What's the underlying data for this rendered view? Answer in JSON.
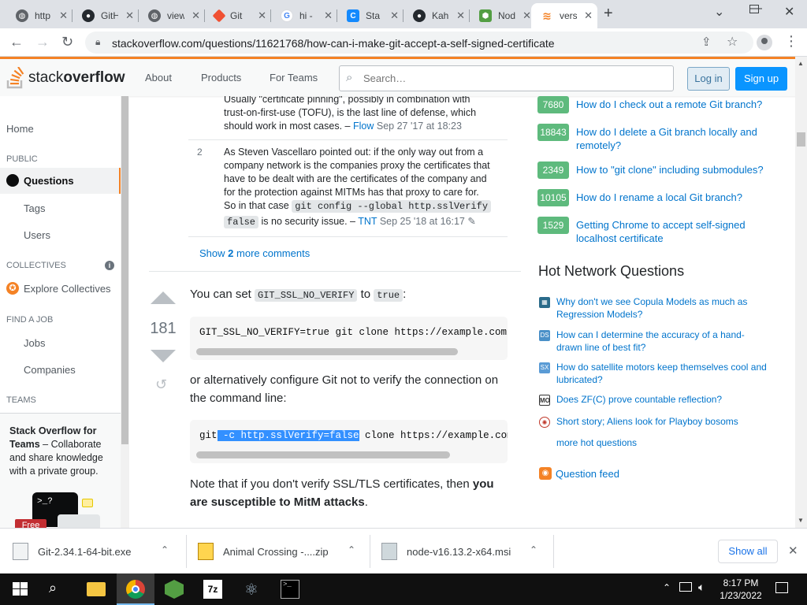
{
  "browser": {
    "tabs": [
      {
        "label": "http",
        "icon": "globe-icon"
      },
      {
        "label": "GitH",
        "icon": "github-icon"
      },
      {
        "label": "view",
        "icon": "globe-icon"
      },
      {
        "label": "Git",
        "icon": "git-icon"
      },
      {
        "label": "hi -",
        "icon": "google-icon"
      },
      {
        "label": "Sta",
        "icon": "stackblitz-icon"
      },
      {
        "label": "Kah",
        "icon": "github-icon"
      },
      {
        "label": "Nod",
        "icon": "nodejs-icon"
      },
      {
        "label": "vers",
        "icon": "stackoverflow-icon"
      }
    ],
    "new_tab": "+",
    "url": "stackoverflow.com/questions/11621768/how-can-i-make-git-accept-a-self-signed-certificate"
  },
  "header": {
    "logo_text_1": "stack",
    "logo_text_2": "overflow",
    "nav": [
      "About",
      "Products",
      "For Teams"
    ],
    "search_placeholder": "Search…",
    "login": "Log in",
    "signup": "Sign up"
  },
  "leftnav": {
    "home": "Home",
    "public": "PUBLIC",
    "questions": "Questions",
    "tags": "Tags",
    "users": "Users",
    "collectives": "COLLECTIVES",
    "explore_collectives": "Explore Collectives",
    "find_a_job": "FIND A JOB",
    "jobs": "Jobs",
    "companies": "Companies",
    "teams": "TEAMS",
    "teams_title": "Stack Overflow for Teams",
    "teams_dash": " – Collaborate and share knowledge with a private group.",
    "free_badge": "Free"
  },
  "comments": {
    "c1_line1": "Usually \"certificate pinning\", possibly in combination with",
    "c1_line2": "trust-on-first-use (TOFU), is the last line of defense, which",
    "c1_line3": "should work in most cases. –",
    "c1_user": "Flow",
    "c1_date": "Sep 27 '17 at 18:23",
    "c2_score": "2",
    "c2_line1": "As Steven Vascellaro pointed out: if the only way out from a",
    "c2_line2": "company network is the companies proxy the certificates that",
    "c2_line3": "have to be dealt with are the certificates of the company and",
    "c2_line4": "for the protection against MITMs has that proxy to care for.",
    "c2_line5": "So in that case",
    "c2_code_1": "git config --global http.sslVerify",
    "c2_code_2": "false",
    "c2_line6": "is no security issue. –",
    "c2_user": "TNT",
    "c2_date": "Sep 25 '18 at 16:17",
    "show_more_pre": "Show",
    "show_more_count": "2",
    "show_more_post": "more comments"
  },
  "answer": {
    "score": "181",
    "p1_pre": "You can set",
    "p1_code_1": "GIT_SSL_NO_VERIFY",
    "p1_mid": "to",
    "p1_code_2": "true",
    "p1_post": ":",
    "code1": "GIT_SSL_NO_VERIFY=true git clone https://example.com/pa",
    "p2_line1": "or alternatively configure Git not to verify the connection on",
    "p2_line2": "the command line:",
    "code2_pre": "git",
    "code2_sel": " -c http.sslVerify=false",
    "code2_post": " clone https://example.com/p",
    "p3_line1_pre": "Note that if you don't verify SSL/TLS certificates, then",
    "p3_line1_bold": "you",
    "p3_line2_bold": "are susceptible to MitM attacks",
    "p3_line2_post": "."
  },
  "linked": [
    {
      "count": "7680",
      "q1": "How do I check out a remote Git branch?",
      "q2": ""
    },
    {
      "count": "18843",
      "q1": "How do I delete a Git branch locally and",
      "q2": "remotely?"
    },
    {
      "count": "2349",
      "q1": "How to \"git clone\" including submodules?",
      "q2": ""
    },
    {
      "count": "10105",
      "q1": "How do I rename a local Git branch?",
      "q2": ""
    },
    {
      "count": "1529",
      "q1": "Getting Chrome to accept self-signed",
      "q2": "localhost certificate"
    }
  ],
  "hot": {
    "title": "Hot Network Questions",
    "items": [
      {
        "icon": "stats-site-icon",
        "q1": "Why don't we see Copula Models as much as",
        "q2": "Regression Models?",
        "color": "#2a6b8a"
      },
      {
        "icon": "datascience-site-icon",
        "q1": "How can I determine the accuracy of a hand-",
        "q2": "drawn line of best fit?",
        "color": "#4a90c8"
      },
      {
        "icon": "space-site-icon",
        "q1": "How do satellite motors keep themselves cool and",
        "q2": "lubricated?",
        "color": "#5a9bd5"
      },
      {
        "icon": "mathoverflow-site-icon",
        "q1": "Does ZF(C) prove countable reflection?",
        "q2": "",
        "color": "#333333"
      },
      {
        "icon": "worldbuilding-site-icon",
        "q1": "Short story; Aliens look for Playboy bosoms",
        "q2": "",
        "color": "#c0392b"
      }
    ],
    "more": "more hot questions",
    "feed": "Question feed"
  },
  "downloads": {
    "items": [
      "Git-2.34.1-64-bit.exe",
      "Animal Crossing -....zip",
      "node-v16.13.2-x64.msi"
    ],
    "show_all": "Show all"
  },
  "taskbar": {
    "time": "8:17 PM",
    "date": "1/23/2022"
  },
  "colors": {
    "so_orange": "#f48225",
    "link_blue": "#0074cc",
    "accepted_green": "#5eba7d",
    "signup_blue": "#0a95ff"
  }
}
